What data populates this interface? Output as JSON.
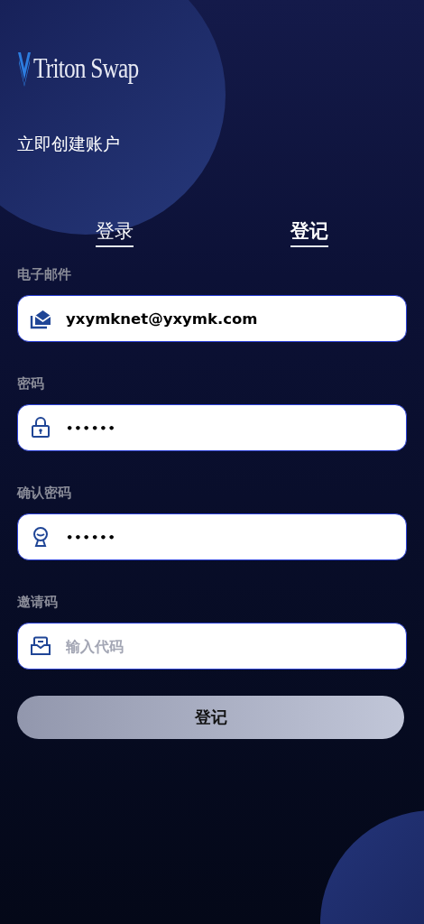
{
  "logo": {
    "text": "Triton Swap"
  },
  "heading": "立即创建账户",
  "tabs": [
    {
      "label": "登录",
      "selected": false
    },
    {
      "label": "登记",
      "selected": true
    }
  ],
  "fields": [
    {
      "label": "电子邮件",
      "kind": "email",
      "value": "yxymknet@yxymk.com"
    },
    {
      "label": "密码",
      "kind": "password",
      "value": "••••••"
    },
    {
      "label": "确认密码",
      "kind": "confirm",
      "value": "••••••"
    },
    {
      "label": "邀请码",
      "kind": "invite",
      "placeholder": "输入代码"
    }
  ],
  "submit": "登记"
}
